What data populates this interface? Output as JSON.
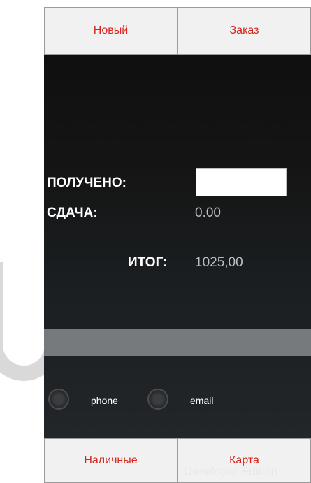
{
  "top_bar": {
    "new_label": "Новый",
    "order_label": "Заказ"
  },
  "payment": {
    "received_label": "ПОЛУЧЕНО:",
    "received_value": "",
    "change_label": "СДАЧА:",
    "change_value": "0.00",
    "total_label": "ИТОГ:",
    "total_value": "1025,00"
  },
  "contact": {
    "phone_label": "phone",
    "email_label": "email"
  },
  "bottom_bar": {
    "cash_label": "Наличные",
    "card_label": "Карта"
  },
  "watermark": "Developer Edition",
  "colors": {
    "accent_text": "#d9251c",
    "button_bg": "#f1f1f1"
  }
}
